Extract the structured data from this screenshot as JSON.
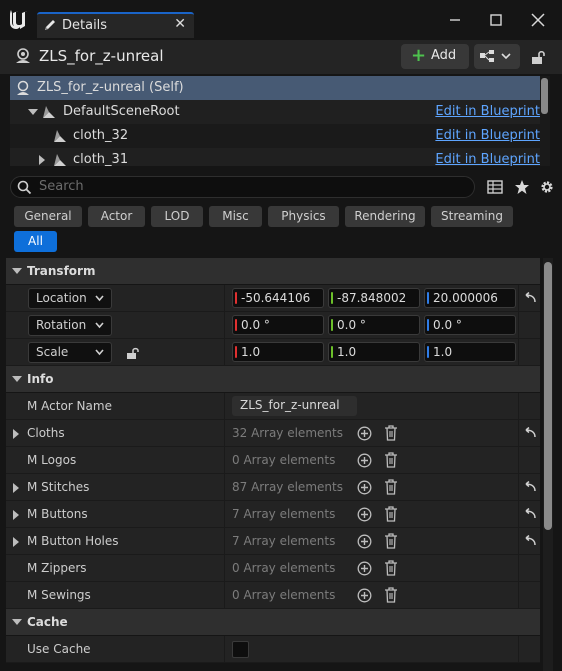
{
  "window": {
    "tab_label": "Details",
    "close_glyph": "✕",
    "minimize_glyph": "—",
    "maximize_glyph": "☐",
    "window_close_glyph": "✕"
  },
  "actor": {
    "name": "ZLS_for_z-unreal",
    "add_label": "Add"
  },
  "tree": {
    "items": [
      {
        "label": "ZLS_for_z-unreal (Self)",
        "link": ""
      },
      {
        "label": "DefaultSceneRoot",
        "link": "Edit in Blueprint"
      },
      {
        "label": "cloth_32",
        "link": "Edit in Blueprint"
      },
      {
        "label": "cloth_31",
        "link": "Edit in Blueprint"
      }
    ]
  },
  "search": {
    "placeholder": "Search"
  },
  "filters": [
    "General",
    "Actor",
    "LOD",
    "Misc",
    "Physics",
    "Rendering",
    "Streaming",
    "All"
  ],
  "sections": {
    "transform": "Transform",
    "info": "Info",
    "cache": "Cache"
  },
  "transform": {
    "location": {
      "label": "Location",
      "x": "-50.644106",
      "y": "-87.848002",
      "z": "20.000006"
    },
    "rotation": {
      "label": "Rotation",
      "x": "0.0 °",
      "y": "0.0 °",
      "z": "0.0 °"
    },
    "scale": {
      "label": "Scale",
      "x": "1.0",
      "y": "1.0",
      "z": "1.0"
    }
  },
  "info": {
    "actor_name_label": "M Actor Name",
    "actor_name_value": "ZLS_for_z-unreal",
    "arrays": [
      {
        "label": "Cloths",
        "value": "32 Array elements"
      },
      {
        "label": "M Logos",
        "value": "0 Array elements"
      },
      {
        "label": "M Stitches",
        "value": "87 Array elements"
      },
      {
        "label": "M Buttons",
        "value": "7 Array elements"
      },
      {
        "label": "M Button Holes",
        "value": "7 Array elements"
      },
      {
        "label": "M Zippers",
        "value": "0 Array elements"
      },
      {
        "label": "M Sewings",
        "value": "0 Array elements"
      }
    ]
  },
  "cache": {
    "use_cache_label": "Use Cache"
  },
  "colors": {
    "accent": "#0e6fda",
    "x_axis": "#e03030",
    "y_axis": "#6cc02a",
    "z_axis": "#2f7de8",
    "link": "#5ea5ff"
  }
}
